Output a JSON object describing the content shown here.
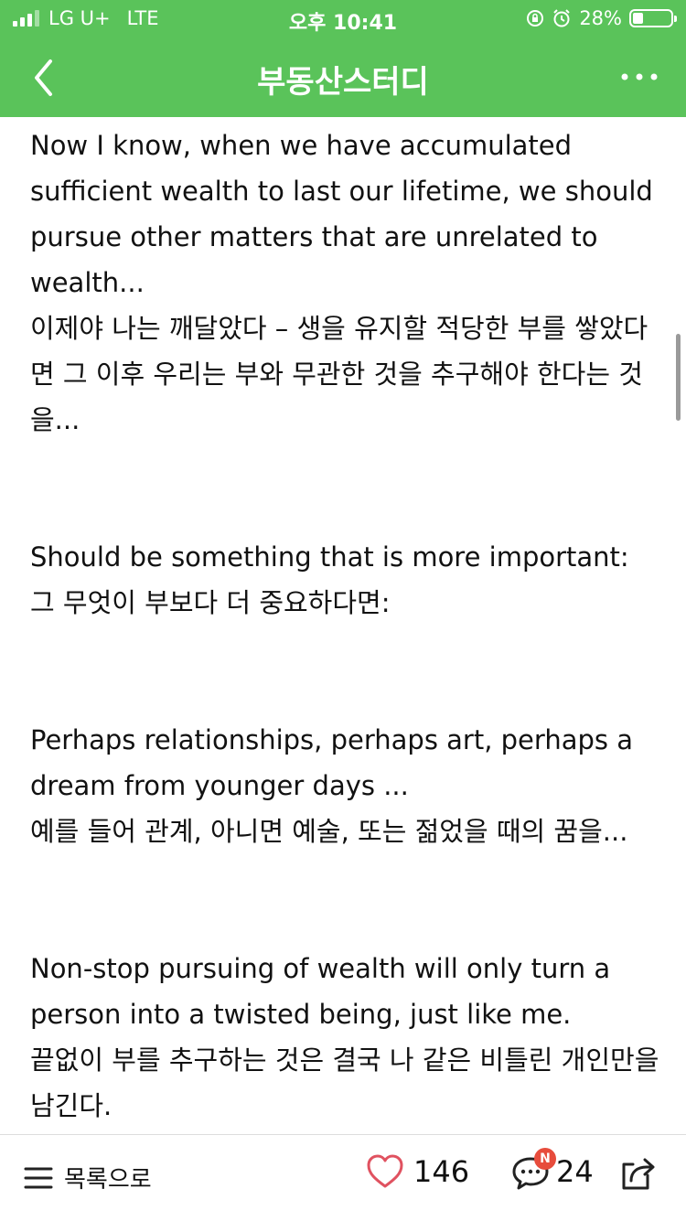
{
  "status_bar": {
    "carrier": "LG U+",
    "network": "LTE",
    "time": "오후 10:41",
    "battery_percent": "28%",
    "battery_level": 0.28
  },
  "nav": {
    "title": "부동산스터디"
  },
  "content": {
    "paragraphs": [
      {
        "en": "Now I know, when we have accumulated sufficient wealth to last our lifetime, we should pursue other matters that are unrelated to wealth...",
        "ko": "이제야 나는 깨달았다 – 생을 유지할 적당한 부를 쌓았다면 그 이후 우리는 부와 무관한 것을 추구해야 한다는 것을..."
      },
      {
        "en": "Should be something that is more important:",
        "ko": "그 무엇이 부보다 더 중요하다면:"
      },
      {
        "en": "Perhaps relationships, perhaps art, perhaps a dream from younger days ...",
        "ko": "예를 들어 관계, 아니면 예술, 또는 젊었을 때의 꿈을..."
      },
      {
        "en": "Non-stop pursuing of wealth will only turn a person into a twisted being, just like me.",
        "ko": "끝없이 부를 추구하는 것은 결국 나 같은 비틀린 개인만을 남긴다."
      }
    ]
  },
  "bottom_bar": {
    "list_label": "목록으로",
    "like_count": "146",
    "comment_count": "24",
    "new_badge": "N"
  },
  "colors": {
    "header_green": "#5ac35a",
    "like_red": "#e05260",
    "badge_red": "#e74c3c"
  }
}
